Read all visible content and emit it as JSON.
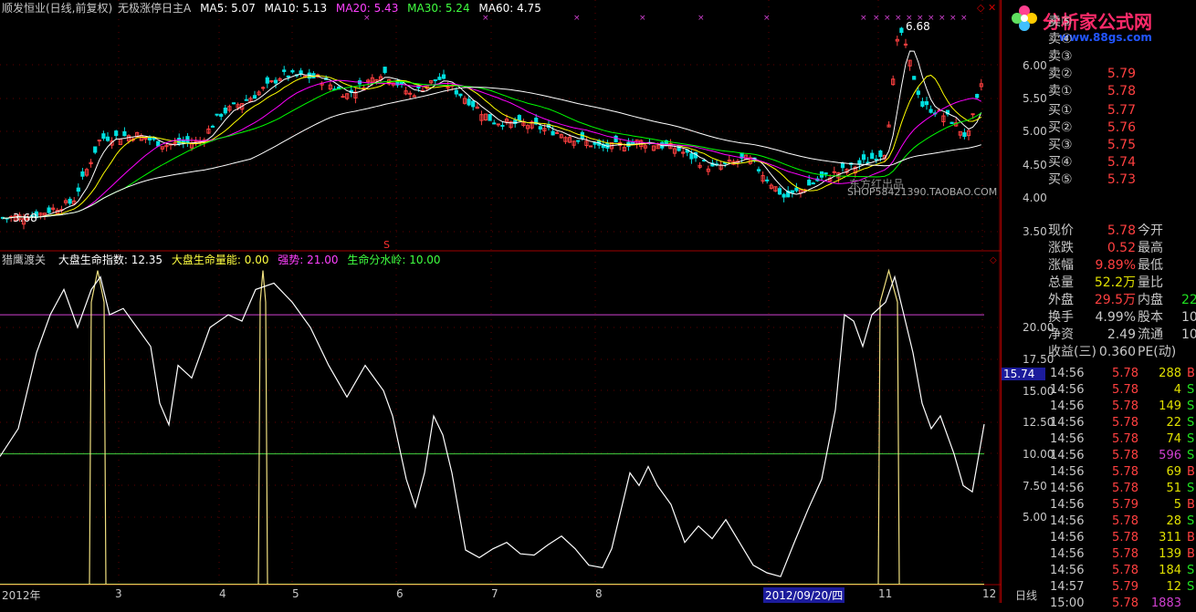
{
  "header": {
    "stock": "顺发恒业(日线,前复权)",
    "indicator": "无极涨停日主A",
    "ma5": "MA5: 5.07",
    "ma10": "MA10: 5.13",
    "ma20": "MA20: 5.43",
    "ma30": "MA30: 5.24",
    "ma60": "MA60: 4.75"
  },
  "sub_header": {
    "name": "猎鹰渡关",
    "f1": "大盘生命指数: 12.35",
    "f2": "大盘生命量能: 0.00",
    "f3": "强势: 21.00",
    "f4": "生命分水岭: 10.00"
  },
  "price_axis": [
    "6.00",
    "5.50",
    "5.00",
    "4.50",
    "4.00",
    "3.50"
  ],
  "ind_axis": [
    "20.00",
    "17.50",
    "15.00",
    "12.50",
    "10.00",
    "7.50",
    "5.00"
  ],
  "current_ind": "15.74",
  "annotations": {
    "high": "6.68",
    "low": "3.68",
    "watermark_cn": "东方红出品",
    "watermark_shop": "SHOP58421390.TAOBAO.COM"
  },
  "x_axis": [
    "2012年",
    "3",
    "4",
    "5",
    "6",
    "7",
    "8",
    "2012/09/20/四",
    "11",
    "12"
  ],
  "period_label": "日线",
  "logo": {
    "title": "分析家公式网",
    "url": "www.88gs.com"
  },
  "sell_orders": [
    {
      "label": "卖⑤",
      "price": ""
    },
    {
      "label": "卖④",
      "price": ""
    },
    {
      "label": "卖③",
      "price": ""
    },
    {
      "label": "卖②",
      "price": "5.79"
    },
    {
      "label": "卖①",
      "price": "5.78"
    }
  ],
  "buy_orders": [
    {
      "label": "买①",
      "price": "5.77"
    },
    {
      "label": "买②",
      "price": "5.76"
    },
    {
      "label": "买③",
      "price": "5.75"
    },
    {
      "label": "买④",
      "price": "5.74"
    },
    {
      "label": "买⑤",
      "price": "5.73"
    }
  ],
  "quote": [
    {
      "l1": "现价",
      "v1": "5.78",
      "c1": "#ff4040",
      "l2": "今开",
      "v2": ""
    },
    {
      "l1": "涨跌",
      "v1": "0.52",
      "c1": "#ff4040",
      "l2": "最高",
      "v2": ""
    },
    {
      "l1": "涨幅",
      "v1": "9.89%",
      "c1": "#ff4040",
      "l2": "最低",
      "v2": ""
    },
    {
      "l1": "总量",
      "v1": "52.2万",
      "c1": "#e0e000",
      "l2": "量比",
      "v2": ""
    },
    {
      "l1": "外盘",
      "v1": "29.5万",
      "c1": "#ff4040",
      "l2": "内盘",
      "v2": "22"
    },
    {
      "l1": "换手",
      "v1": "4.99%",
      "c1": "#c8c8c8",
      "l2": "股本",
      "v2": "10"
    },
    {
      "l1": "净资",
      "v1": "2.49",
      "c1": "#c8c8c8",
      "l2": "流通",
      "v2": "10"
    },
    {
      "l1": "收益(三)",
      "v1": "0.360",
      "c1": "#c8c8c8",
      "l2": "PE(动)",
      "v2": ""
    }
  ],
  "ticks": [
    {
      "t": "14:56",
      "p": "5.78",
      "v": "288",
      "s": "B",
      "vc": "#e0e000",
      "sc": "#ff4040"
    },
    {
      "t": "14:56",
      "p": "5.78",
      "v": "4",
      "s": "S",
      "vc": "#e0e000",
      "sc": "#20e020"
    },
    {
      "t": "14:56",
      "p": "5.78",
      "v": "149",
      "s": "S",
      "vc": "#e0e000",
      "sc": "#20e020"
    },
    {
      "t": "14:56",
      "p": "5.78",
      "v": "22",
      "s": "S",
      "vc": "#e0e000",
      "sc": "#20e020"
    },
    {
      "t": "14:56",
      "p": "5.78",
      "v": "74",
      "s": "S",
      "vc": "#e0e000",
      "sc": "#20e020"
    },
    {
      "t": "14:56",
      "p": "5.78",
      "v": "596",
      "s": "S",
      "vc": "#d040d0",
      "sc": "#20e020"
    },
    {
      "t": "14:56",
      "p": "5.78",
      "v": "69",
      "s": "B",
      "vc": "#e0e000",
      "sc": "#ff4040"
    },
    {
      "t": "14:56",
      "p": "5.78",
      "v": "51",
      "s": "S",
      "vc": "#e0e000",
      "sc": "#20e020"
    },
    {
      "t": "14:56",
      "p": "5.79",
      "v": "5",
      "s": "B",
      "vc": "#e0e000",
      "sc": "#ff4040"
    },
    {
      "t": "14:56",
      "p": "5.78",
      "v": "28",
      "s": "S",
      "vc": "#e0e000",
      "sc": "#20e020"
    },
    {
      "t": "14:56",
      "p": "5.78",
      "v": "311",
      "s": "B",
      "vc": "#e0e000",
      "sc": "#ff4040"
    },
    {
      "t": "14:56",
      "p": "5.78",
      "v": "139",
      "s": "B",
      "vc": "#e0e000",
      "sc": "#ff4040"
    },
    {
      "t": "14:56",
      "p": "5.78",
      "v": "184",
      "s": "S",
      "vc": "#e0e000",
      "sc": "#20e020"
    },
    {
      "t": "14:57",
      "p": "5.79",
      "v": "12",
      "s": "S",
      "vc": "#e0e000",
      "sc": "#20e020"
    },
    {
      "t": "15:00",
      "p": "5.78",
      "v": "1883",
      "s": "",
      "vc": "#d040d0",
      "sc": "#20e020"
    }
  ],
  "colors": {
    "up": "#ff4040",
    "down": "#00e0e0",
    "ma5": "#ffffff",
    "ma10": "#ffff00",
    "ma20": "#ff00ff",
    "ma30": "#00ff00",
    "ma60": "#ffffff",
    "axis": "#a00000"
  }
}
